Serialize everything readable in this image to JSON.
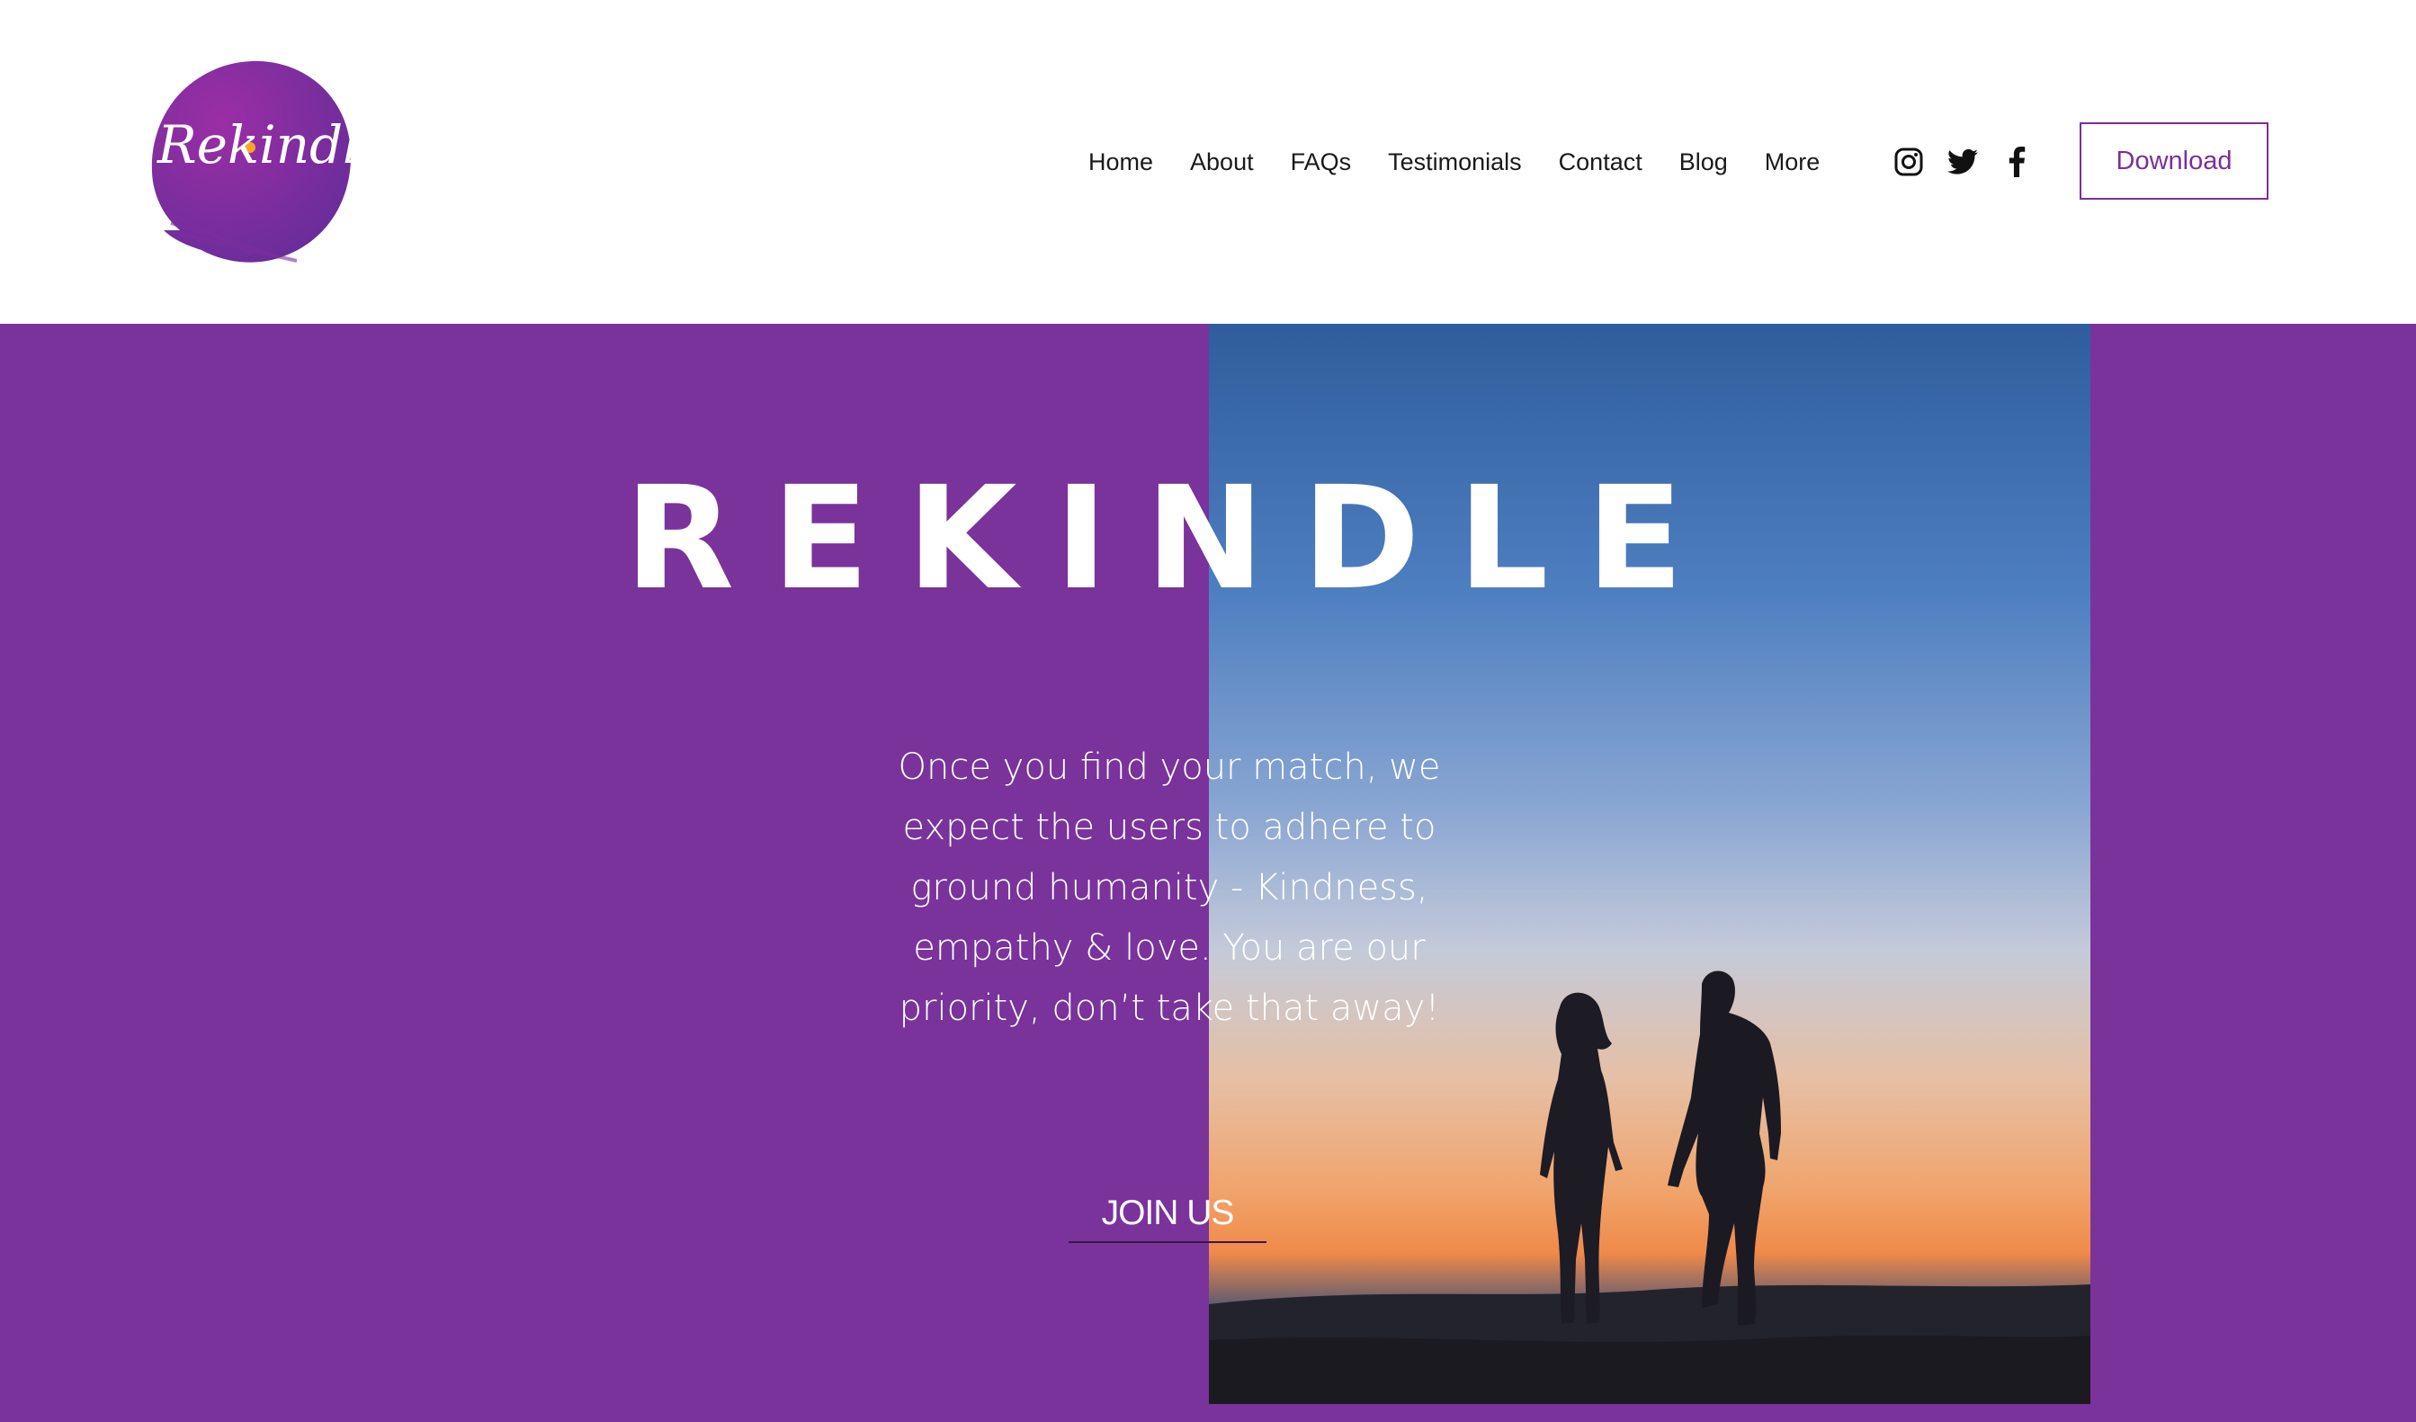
{
  "brand": {
    "logo_text": "Rekindle",
    "logo_icon": "brush-circle-logo",
    "primary_color": "#7a339b",
    "accent_color": "#f5a623"
  },
  "nav": {
    "items": [
      {
        "label": "Home"
      },
      {
        "label": "About"
      },
      {
        "label": "FAQs"
      },
      {
        "label": "Testimonials"
      },
      {
        "label": "Contact"
      },
      {
        "label": "Blog"
      },
      {
        "label": "More"
      }
    ]
  },
  "social": [
    {
      "name": "instagram-icon"
    },
    {
      "name": "twitter-icon"
    },
    {
      "name": "facebook-icon"
    }
  ],
  "header": {
    "download_label": "Download"
  },
  "hero": {
    "title": "REKINDLE",
    "description": "Once you find your match, we expect the users to adhere to ground humanity - Kindness, empathy & love. You are our priority, don’t take that away!",
    "cta_label": "JOIN US",
    "image": "couple-silhouette-sunset-photo"
  }
}
